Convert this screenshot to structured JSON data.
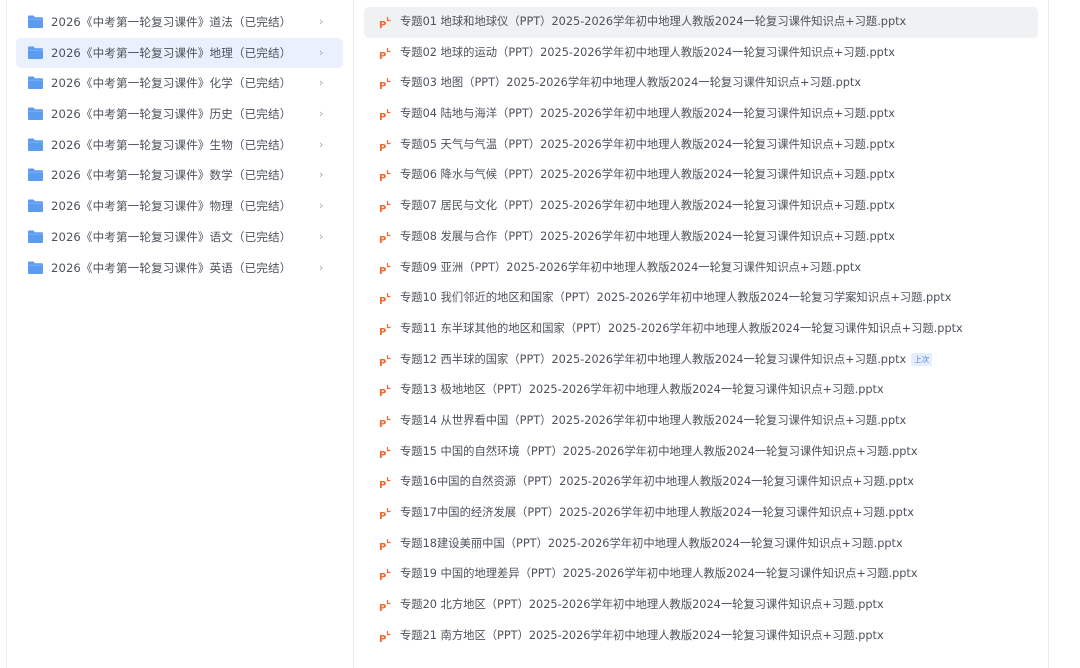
{
  "folders": [
    {
      "label": "2026《中考第一轮复习课件》道法（已完结）",
      "chevron": "›",
      "selected": false
    },
    {
      "label": "2026《中考第一轮复习课件》地理（已完结）",
      "chevron": "›",
      "selected": true
    },
    {
      "label": "2026《中考第一轮复习课件》化学（已完结）",
      "chevron": "›",
      "selected": false
    },
    {
      "label": "2026《中考第一轮复习课件》历史（已完结）",
      "chevron": "›",
      "selected": false
    },
    {
      "label": "2026《中考第一轮复习课件》生物（已完结）",
      "chevron": "›",
      "selected": false
    },
    {
      "label": "2026《中考第一轮复习课件》数学（已完结）",
      "chevron": "›",
      "selected": false
    },
    {
      "label": "2026《中考第一轮复习课件》物理（已完结）",
      "chevron": "›",
      "selected": false
    },
    {
      "label": "2026《中考第一轮复习课件》语文（已完结）",
      "chevron": "›",
      "selected": false
    },
    {
      "label": "2026《中考第一轮复习课件》英语（已完结）",
      "chevron": "›",
      "selected": false
    }
  ],
  "files": [
    {
      "label": "专题01  地球和地球仪（PPT）2025-2026学年初中地理人教版2024一轮复习课件知识点+习题.pptx",
      "selected": true
    },
    {
      "label": "专题02 地球的运动（PPT）2025-2026学年初中地理人教版2024一轮复习课件知识点+习题.pptx"
    },
    {
      "label": "专题03  地图（PPT）2025-2026学年初中地理人教版2024一轮复习课件知识点+习题.pptx"
    },
    {
      "label": "专题04 陆地与海洋（PPT）2025-2026学年初中地理人教版2024一轮复习课件知识点+习题.pptx"
    },
    {
      "label": "专题05 天气与气温（PPT）2025-2026学年初中地理人教版2024一轮复习课件知识点+习题.pptx"
    },
    {
      "label": "专题06 降水与气候（PPT）2025-2026学年初中地理人教版2024一轮复习课件知识点+习题.pptx"
    },
    {
      "label": "专题07 居民与文化（PPT）2025-2026学年初中地理人教版2024一轮复习课件知识点+习题.pptx"
    },
    {
      "label": "专题08 发展与合作（PPT）2025-2026学年初中地理人教版2024一轮复习课件知识点+习题.pptx"
    },
    {
      "label": "专题09 亚洲（PPT）2025-2026学年初中地理人教版2024一轮复习课件知识点+习题.pptx"
    },
    {
      "label": "专题10 我们邻近的地区和国家（PPT）2025-2026学年初中地理人教版2024一轮复习学案知识点+习题.pptx"
    },
    {
      "label": "专题11 东半球其他的地区和国家（PPT）2025-2026学年初中地理人教版2024一轮复习课件知识点+习题.pptx"
    },
    {
      "label": "专题12 西半球的国家（PPT）2025-2026学年初中地理人教版2024一轮复习课件知识点+习题.pptx",
      "badge": "上次"
    },
    {
      "label": "专题13 极地地区（PPT）2025-2026学年初中地理人教版2024一轮复习课件知识点+习题.pptx"
    },
    {
      "label": "专题14 从世界看中国（PPT）2025-2026学年初中地理人教版2024一轮复习课件知识点+习题.pptx"
    },
    {
      "label": "专题15 中国的自然环境（PPT）2025-2026学年初中地理人教版2024一轮复习课件知识点+习题.pptx"
    },
    {
      "label": "专题16中国的自然资源（PPT）2025-2026学年初中地理人教版2024一轮复习课件知识点+习题.pptx"
    },
    {
      "label": "专题17中国的经济发展（PPT）2025-2026学年初中地理人教版2024一轮复习课件知识点+习题.pptx"
    },
    {
      "label": "专题18建设美丽中国（PPT）2025-2026学年初中地理人教版2024一轮复习课件知识点+习题.pptx"
    },
    {
      "label": "专题19  中国的地理差异（PPT）2025-2026学年初中地理人教版2024一轮复习课件知识点+习题.pptx"
    },
    {
      "label": "专题20  北方地区（PPT）2025-2026学年初中地理人教版2024一轮复习课件知识点+习题.pptx"
    },
    {
      "label": "专题21  南方地区（PPT）2025-2026学年初中地理人教版2024一轮复习课件知识点+习题.pptx"
    }
  ],
  "icons": {
    "folder": "folder-icon",
    "file": "ppt-file-icon"
  },
  "colors": {
    "folder": "#5b9bf0",
    "ppt": "#f06a2f",
    "selected_folder_bg": "#eaf1fd",
    "selected_file_bg": "#f0f1f3",
    "badge": "#4a7fe0"
  }
}
